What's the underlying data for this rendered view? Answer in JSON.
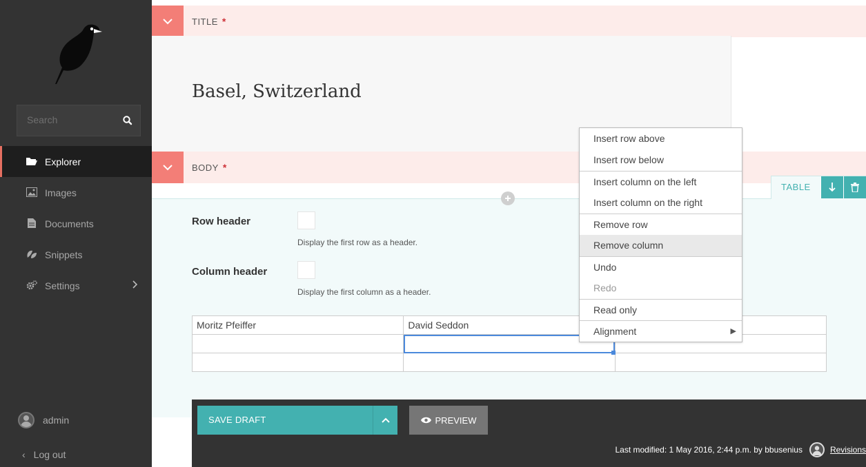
{
  "sidebar": {
    "search_placeholder": "Search",
    "nav": [
      {
        "label": "Explorer",
        "icon": "folder-open-icon",
        "active": true
      },
      {
        "label": "Images",
        "icon": "image-icon"
      },
      {
        "label": "Documents",
        "icon": "document-icon"
      },
      {
        "label": "Snippets",
        "icon": "snippet-icon"
      },
      {
        "label": "Settings",
        "icon": "cogs-icon",
        "has_submenu": true
      }
    ],
    "account_name": "admin",
    "logout_label": "Log out"
  },
  "title_field": {
    "label": "TITLE",
    "required_mark": "*",
    "value": "Basel, Switzerland"
  },
  "body_field": {
    "label": "BODY",
    "required_mark": "*",
    "block_type": "TABLE",
    "row_header_label": "Row header",
    "row_header_help": "Display the first row as a header.",
    "column_header_label": "Column header",
    "column_header_help": "Display the first column as a header.",
    "table_rows": [
      [
        "Moritz Pfeiffer",
        "David Seddon",
        ""
      ],
      [
        "",
        "",
        ""
      ],
      [
        "",
        "",
        ""
      ]
    ]
  },
  "context_menu": {
    "items": [
      {
        "label": "Insert row above"
      },
      {
        "label": "Insert row below"
      },
      {
        "label": "Insert column on the left"
      },
      {
        "label": "Insert column on the right"
      },
      {
        "label": "Remove row"
      },
      {
        "label": "Remove column"
      },
      {
        "label": "Undo"
      },
      {
        "label": "Redo"
      },
      {
        "label": "Read only"
      },
      {
        "label": "Alignment"
      }
    ],
    "hovered": "Remove column",
    "disabled": [
      "Redo"
    ]
  },
  "footer": {
    "save_label": "SAVE DRAFT",
    "preview_label": "PREVIEW",
    "last_modified": "Last modified: 1 May 2016, 2:44 p.m. by bbusenius",
    "revisions_label": "Revisions"
  },
  "colors": {
    "accent_teal": "#43b1b0",
    "accent_red": "#f37e77",
    "sidebar_bg": "#333333"
  }
}
